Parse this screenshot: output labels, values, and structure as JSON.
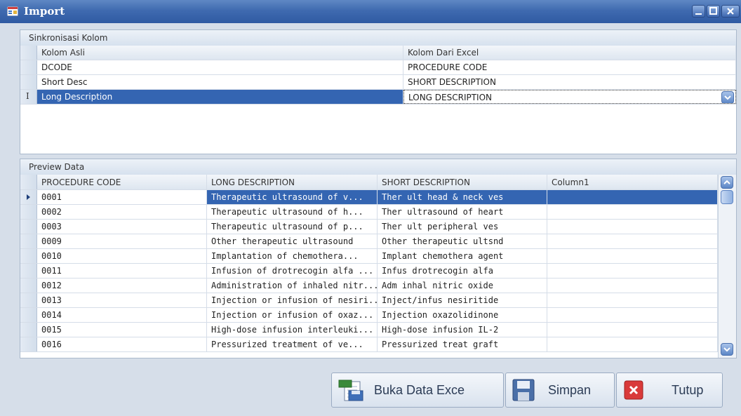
{
  "window": {
    "title": "Import"
  },
  "sync": {
    "caption": "Sinkronisasi Kolom",
    "col_headers": [
      "Kolom Asli",
      "Kolom Dari Excel"
    ],
    "rows": [
      {
        "asli": "DCODE",
        "excel": "PROCEDURE CODE"
      },
      {
        "asli": "Short Desc",
        "excel": "SHORT DESCRIPTION"
      },
      {
        "asli": "Long Description",
        "excel": "LONG DESCRIPTION"
      }
    ],
    "edit_marker": "I"
  },
  "preview": {
    "caption": "Preview Data",
    "col_headers": [
      "PROCEDURE CODE",
      "LONG DESCRIPTION",
      "SHORT DESCRIPTION",
      "Column1"
    ],
    "rows": [
      [
        "0001",
        "Therapeutic ultrasound of v...",
        "Ther ult head & neck ves",
        ""
      ],
      [
        "0002",
        "Therapeutic ultrasound of h...",
        "Ther ultrasound of heart",
        ""
      ],
      [
        "0003",
        "Therapeutic ultrasound of p...",
        "Ther ult peripheral ves",
        ""
      ],
      [
        "0009",
        "Other therapeutic ultrasound",
        "Other therapeutic ultsnd",
        ""
      ],
      [
        "0010",
        "Implantation of chemothera...",
        "Implant chemothera agent",
        ""
      ],
      [
        "0011",
        "Infusion of drotrecogin alfa ...",
        "Infus drotrecogin alfa",
        ""
      ],
      [
        "0012",
        "Administration of inhaled nitr...",
        "Adm inhal nitric oxide",
        ""
      ],
      [
        "0013",
        "Injection or infusion of nesiri...",
        "Inject/infus nesiritide",
        ""
      ],
      [
        "0014",
        "Injection or infusion of oxaz...",
        "Injection oxazolidinone",
        ""
      ],
      [
        "0015",
        "High-dose infusion interleuki...",
        "High-dose infusion IL-2",
        ""
      ],
      [
        "0016",
        "Pressurized treatment of ve...",
        "Pressurized treat graft",
        ""
      ]
    ]
  },
  "buttons": {
    "buka": "Buka Data Exce",
    "simpan": "Simpan",
    "tutup": "Tutup"
  },
  "colors": {
    "title_bar": "#3f6ab0",
    "selection": "#3465b2"
  }
}
